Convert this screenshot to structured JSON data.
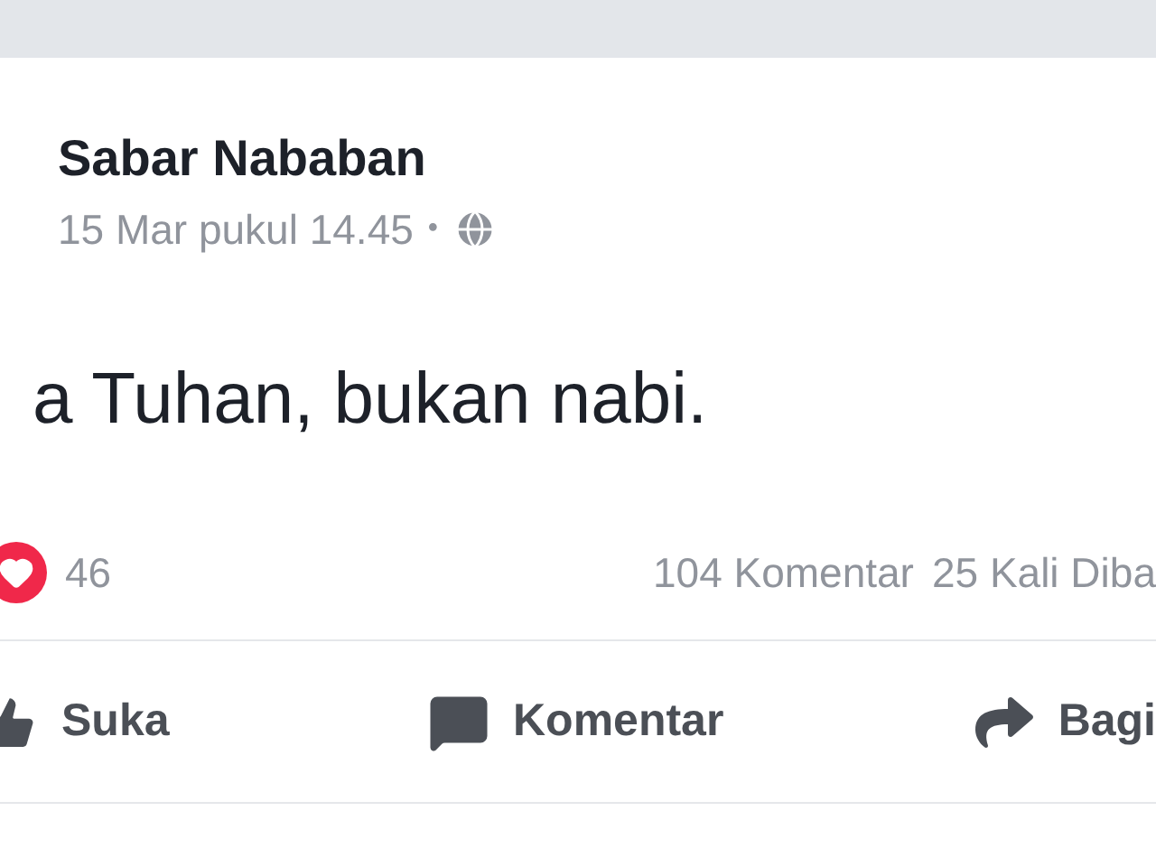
{
  "post": {
    "author": "Sabar Nababan",
    "time": "15 Mar pukul 14.45",
    "separator": "•",
    "text": "a Tuhan, bukan nabi."
  },
  "stats": {
    "reactions": "46",
    "comments": "104 Komentar",
    "shares": "25 Kali Diba"
  },
  "actions": [
    {
      "kind": "like",
      "label": "Suka"
    },
    {
      "kind": "comment",
      "label": "Komentar"
    },
    {
      "kind": "share",
      "label": "Bagi"
    }
  ]
}
